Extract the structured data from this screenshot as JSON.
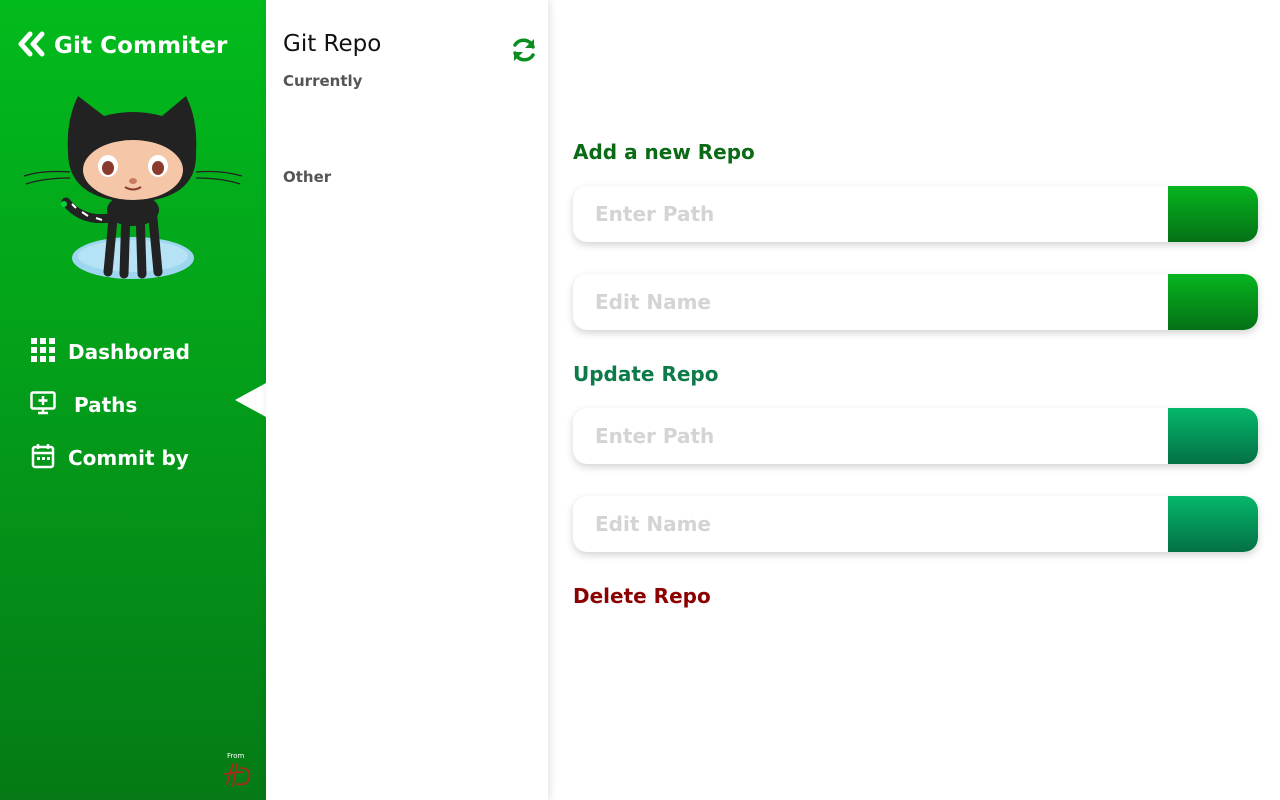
{
  "app": {
    "title": "Git Commiter"
  },
  "sidebar": {
    "items": [
      {
        "label": "Dashborad",
        "icon": "grid-icon"
      },
      {
        "label": "Paths",
        "icon": "monitor-add-icon",
        "active": true
      },
      {
        "label": "Commit by",
        "icon": "calendar-icon"
      }
    ],
    "from_label": "From"
  },
  "panel": {
    "title": "Git Repo",
    "sections": [
      "Currently",
      "Other"
    ]
  },
  "content": {
    "add": {
      "heading": "Add a new Repo",
      "path_placeholder": "Enter Path",
      "name_placeholder": "Edit Name"
    },
    "update": {
      "heading": "Update Repo",
      "path_placeholder": "Enter Path",
      "name_placeholder": "Edit Name"
    },
    "delete": {
      "heading": "Delete Repo"
    }
  },
  "colors": {
    "brand_green": "#03a01a",
    "add_heading": "#0b6a16",
    "update_heading": "#0d7a4a",
    "delete_heading": "#8b0000"
  }
}
